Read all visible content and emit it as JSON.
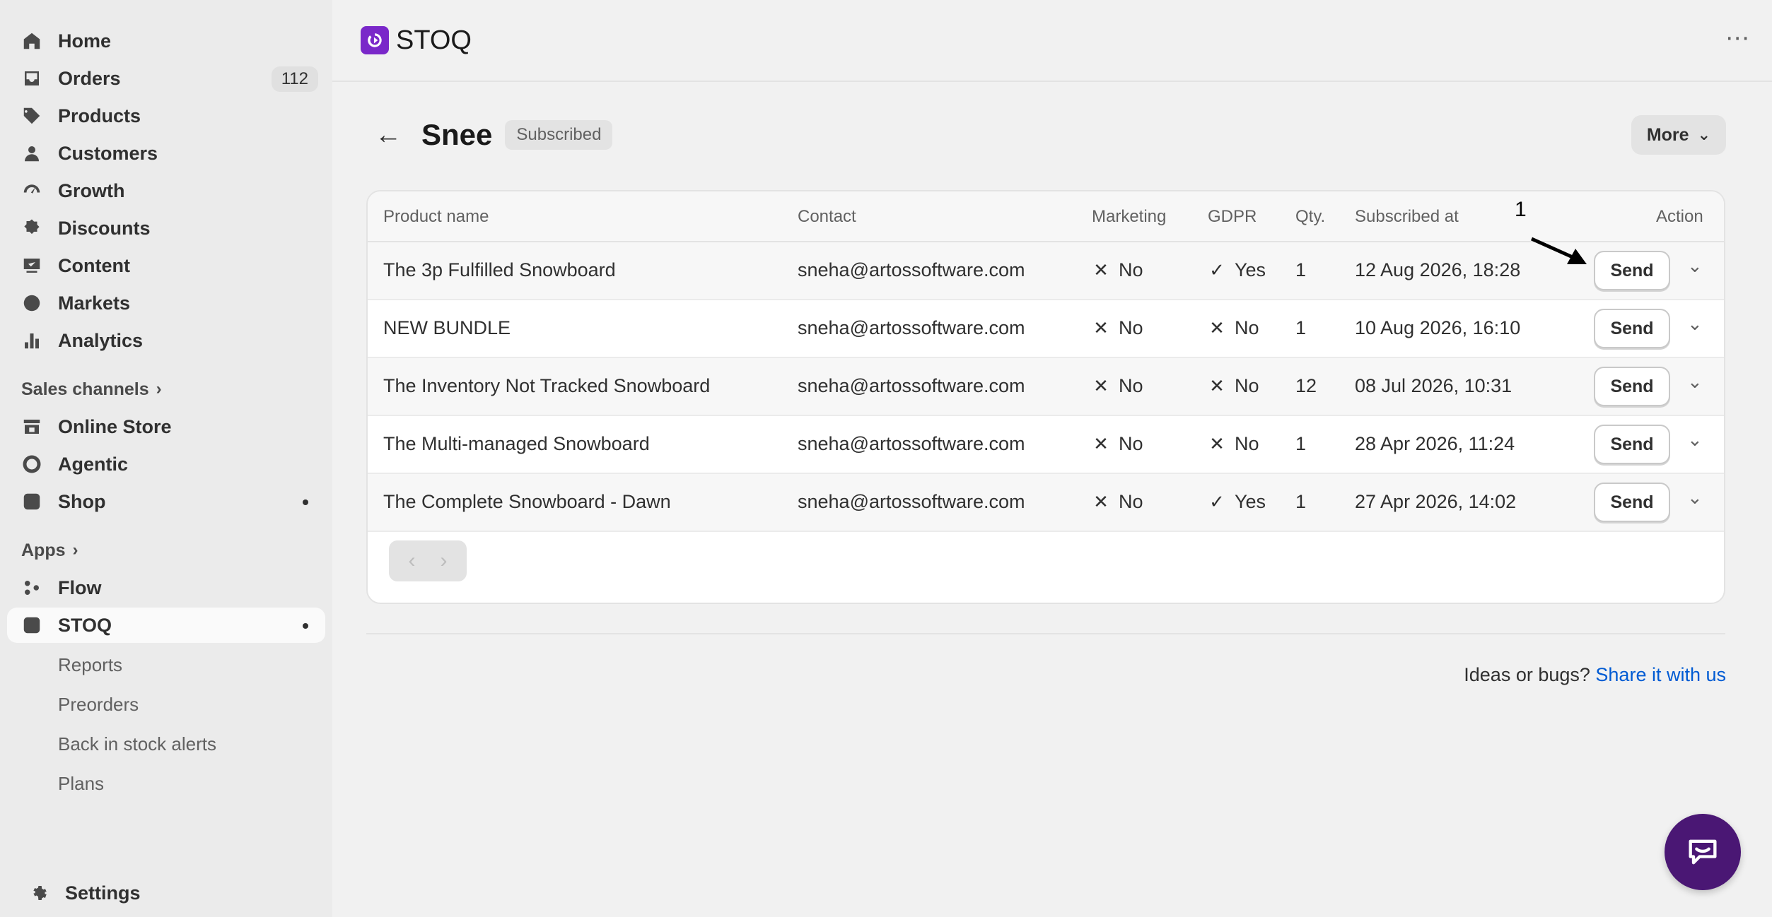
{
  "sidebar": {
    "main_items": [
      {
        "label": "Home",
        "icon": "home-icon"
      },
      {
        "label": "Orders",
        "icon": "inbox-icon",
        "badge": "112"
      },
      {
        "label": "Products",
        "icon": "tag-icon"
      },
      {
        "label": "Customers",
        "icon": "person-icon"
      },
      {
        "label": "Growth",
        "icon": "gauge-icon"
      },
      {
        "label": "Discounts",
        "icon": "discount-icon"
      },
      {
        "label": "Content",
        "icon": "content-icon"
      },
      {
        "label": "Markets",
        "icon": "globe-icon"
      },
      {
        "label": "Analytics",
        "icon": "bar-chart-icon"
      }
    ],
    "sales_channels_label": "Sales channels",
    "sales_channels": [
      {
        "label": "Online Store",
        "icon": "store-icon"
      },
      {
        "label": "Agentic",
        "icon": "agentic-icon"
      },
      {
        "label": "Shop",
        "icon": "shop-icon"
      }
    ],
    "apps_label": "Apps",
    "apps": [
      {
        "label": "Flow",
        "icon": "flow-icon"
      },
      {
        "label": "STOQ",
        "icon": "stoq-icon"
      }
    ],
    "stoq_subitems": [
      "Reports",
      "Preorders",
      "Back in stock alerts",
      "Plans"
    ],
    "settings_label": "Settings"
  },
  "header": {
    "app_name": "STOQ",
    "menu_glyph": "⋯"
  },
  "page": {
    "back_glyph": "←",
    "title": "Snee",
    "status": "Subscribed",
    "more_label": "More"
  },
  "table": {
    "columns": [
      "Product name",
      "Contact",
      "Marketing",
      "GDPR",
      "Qty.",
      "Subscribed at",
      "Action"
    ],
    "rows": [
      {
        "product": "The 3p Fulfilled Snowboard",
        "contact": "sneha@artossoftware.com",
        "marketing": "No",
        "marketing_ok": false,
        "gdpr": "Yes",
        "gdpr_ok": true,
        "qty": "1",
        "subscribed_at": "12 Aug 2026, 18:28",
        "action": "Send"
      },
      {
        "product": "NEW BUNDLE",
        "contact": "sneha@artossoftware.com",
        "marketing": "No",
        "marketing_ok": false,
        "gdpr": "No",
        "gdpr_ok": false,
        "qty": "1",
        "subscribed_at": "10 Aug 2026, 16:10",
        "action": "Send"
      },
      {
        "product": "The Inventory Not Tracked Snowboard",
        "contact": "sneha@artossoftware.com",
        "marketing": "No",
        "marketing_ok": false,
        "gdpr": "No",
        "gdpr_ok": false,
        "qty": "12",
        "subscribed_at": "08 Jul 2026, 10:31",
        "action": "Send"
      },
      {
        "product": "The Multi-managed Snowboard",
        "contact": "sneha@artossoftware.com",
        "marketing": "No",
        "marketing_ok": false,
        "gdpr": "No",
        "gdpr_ok": false,
        "qty": "1",
        "subscribed_at": "28 Apr 2026, 11:24",
        "action": "Send"
      },
      {
        "product": "The Complete Snowboard - Dawn",
        "contact": "sneha@artossoftware.com",
        "marketing": "No",
        "marketing_ok": false,
        "gdpr": "Yes",
        "gdpr_ok": true,
        "qty": "1",
        "subscribed_at": "27 Apr 2026, 14:02",
        "action": "Send"
      }
    ],
    "pager_prev": "‹",
    "pager_next": "›"
  },
  "footer": {
    "prompt": "Ideas or bugs?",
    "link": "Share it with us"
  },
  "annotation": {
    "number": "1"
  },
  "colors": {
    "accent": "#7a28c9",
    "chat_button": "#4a1774",
    "link": "#005bd3"
  }
}
